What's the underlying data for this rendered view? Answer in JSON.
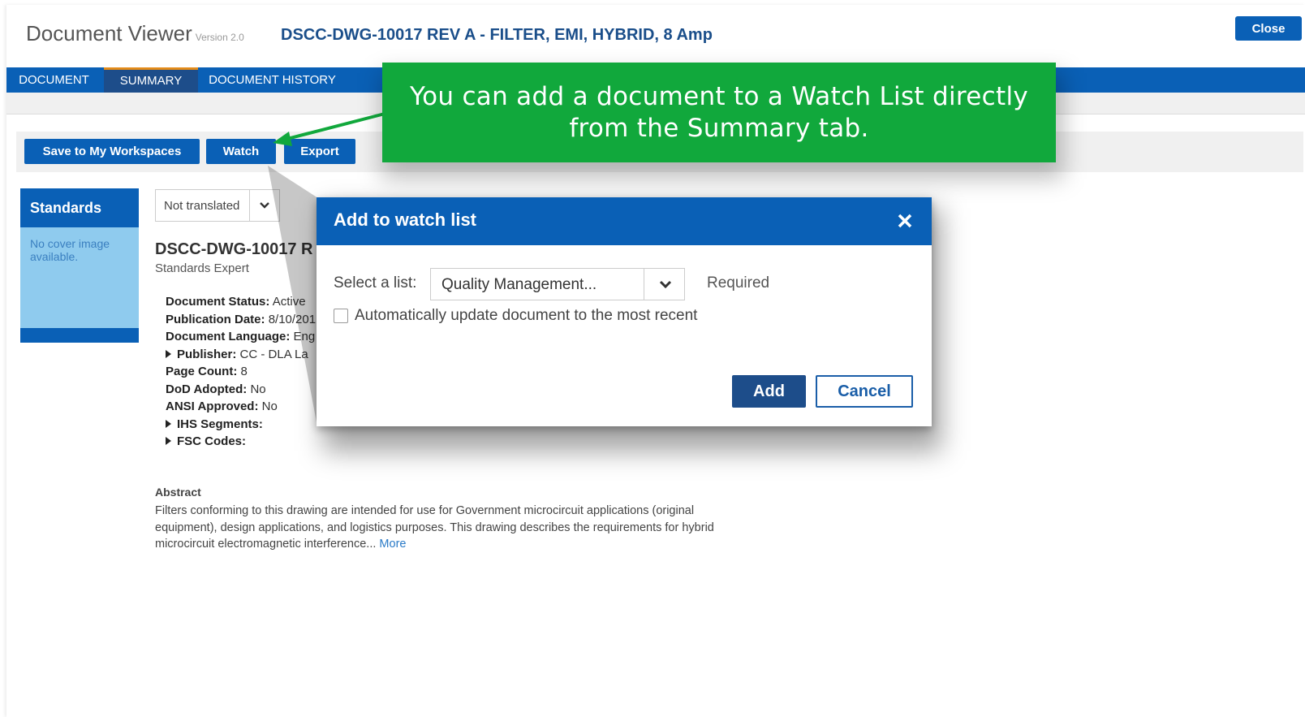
{
  "header": {
    "app_name": "Document Viewer",
    "version": "Version 2.0",
    "doc_title": "DSCC-DWG-10017 REV A - FILTER, EMI, HYBRID, 8 Amp",
    "close_label": "Close"
  },
  "tabs": [
    {
      "label": "DOCUMENT"
    },
    {
      "label": "SUMMARY"
    },
    {
      "label": "DOCUMENT HISTORY"
    }
  ],
  "actions": {
    "save_label": "Save to My Workspaces",
    "watch_label": "Watch",
    "export_label": "Export"
  },
  "standards": {
    "title": "Standards",
    "cover_text": "No cover image available."
  },
  "translation": {
    "selected": "Not translated"
  },
  "meta": {
    "title": "DSCC-DWG-10017 R",
    "subtitle": "Standards Expert",
    "rows": [
      {
        "label": "Document Status:",
        "value": "Active"
      },
      {
        "label": "Publication Date:",
        "value": "8/10/201"
      },
      {
        "label": "Document Language:",
        "value": "Eng"
      },
      {
        "label": "Publisher:",
        "value": "CC - DLA La"
      },
      {
        "label": "Page Count:",
        "value": "8"
      },
      {
        "label": "DoD Adopted:",
        "value": "No"
      },
      {
        "label": "ANSI Approved:",
        "value": "No"
      },
      {
        "label": "IHS Segments:",
        "value": ""
      },
      {
        "label": "FSC Codes:",
        "value": ""
      }
    ]
  },
  "abstract": {
    "heading": "Abstract",
    "text": "Filters conforming to this drawing are intended for use for Government microcircuit applications (original equipment), design applications, and logistics purposes. This drawing describes the requirements for hybrid microcircuit electromagnetic interference...",
    "more_label": "More"
  },
  "callout": {
    "text": "You can add a document to a Watch List directly from the Summary tab."
  },
  "modal": {
    "title": "Add to watch list",
    "select_label": "Select a list:",
    "select_value": "Quality Management...",
    "required_label": "Required",
    "checkbox_label": "Automatically update document to the most recent",
    "add_label": "Add",
    "cancel_label": "Cancel"
  },
  "colors": {
    "brand_blue": "#0a60b6",
    "dark_blue": "#1d4d8a",
    "callout_green": "#11a83c",
    "active_tab_accent": "#e38b1a"
  }
}
